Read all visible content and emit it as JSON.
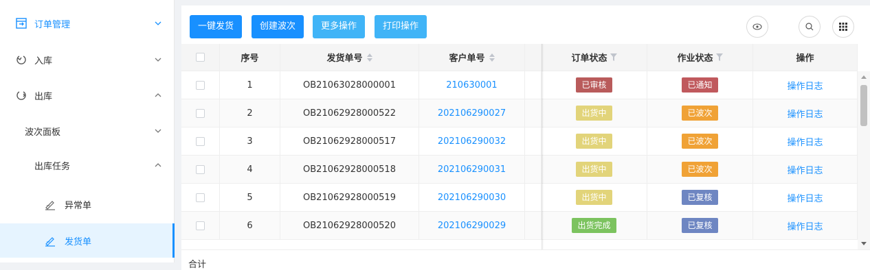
{
  "sidebar": {
    "items": [
      {
        "label": "订单管理",
        "icon": "order-icon",
        "expanded": false
      },
      {
        "label": "入库",
        "icon": "inbound-icon",
        "expanded": false
      },
      {
        "label": "出库",
        "icon": "outbound-icon",
        "expanded": true
      },
      {
        "label": "波次面板",
        "expanded": false
      },
      {
        "label": "出库任务",
        "expanded": true
      },
      {
        "label": "异常单",
        "icon": "task-icon"
      },
      {
        "label": "发货单",
        "icon": "task-icon",
        "active": true
      }
    ]
  },
  "toolbar": {
    "buttons": [
      "一键发货",
      "创建波次",
      "更多操作",
      "打印操作"
    ],
    "icons": [
      "eye-icon",
      "search-icon",
      "grid-icon"
    ]
  },
  "table": {
    "columns": [
      "序号",
      "发货单号",
      "客户单号",
      "订单状态",
      "作业状态",
      "操作"
    ],
    "rows": [
      {
        "index": "1",
        "shipment_no": "OB21063028000001",
        "customer_no": "210630001",
        "order_status": "已审核",
        "order_color": "#b95b5b",
        "work_status": "已通知",
        "work_color": "#c0595d",
        "action": "操作日志"
      },
      {
        "index": "2",
        "shipment_no": "OB21062928000522",
        "customer_no": "202106290027",
        "order_status": "出货中",
        "order_color": "#e2d47a",
        "work_status": "已波次",
        "work_color": "#f0a236",
        "action": "操作日志"
      },
      {
        "index": "3",
        "shipment_no": "OB21062928000517",
        "customer_no": "202106290032",
        "order_status": "出货中",
        "order_color": "#e2d47a",
        "work_status": "已波次",
        "work_color": "#f0a236",
        "action": "操作日志"
      },
      {
        "index": "4",
        "shipment_no": "OB21062928000518",
        "customer_no": "202106290031",
        "order_status": "出货中",
        "order_color": "#e2d47a",
        "work_status": "已波次",
        "work_color": "#f0a236",
        "action": "操作日志"
      },
      {
        "index": "5",
        "shipment_no": "OB21062928000519",
        "customer_no": "202106290030",
        "order_status": "出货中",
        "order_color": "#e2d47a",
        "work_status": "已复核",
        "work_color": "#6e86c2",
        "action": "操作日志"
      },
      {
        "index": "6",
        "shipment_no": "OB21062928000520",
        "customer_no": "202106290029",
        "order_status": "出货完成",
        "order_color": "#7cc35f",
        "work_status": "已复核",
        "work_color": "#6e86c2",
        "action": "操作日志"
      }
    ],
    "footer_label": "合计"
  },
  "colors": {
    "primary": "#1890ff",
    "light_button": "#40b4f7"
  }
}
